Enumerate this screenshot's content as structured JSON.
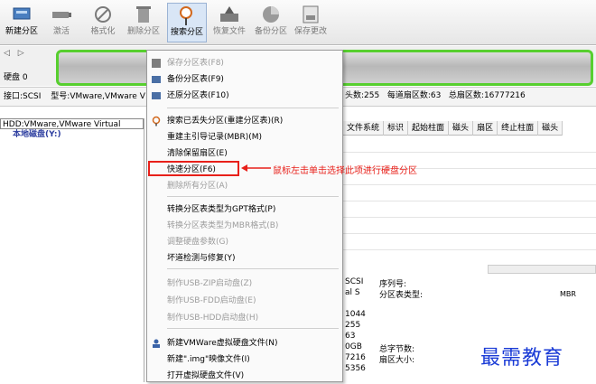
{
  "toolbar": {
    "items": [
      {
        "label": "新建分区",
        "icon": "new-partition-icon"
      },
      {
        "label": "激活",
        "icon": "activate-icon"
      },
      {
        "label": "格式化",
        "icon": "format-icon"
      },
      {
        "label": "删除分区",
        "icon": "delete-partition-icon"
      },
      {
        "label": "搜索分区",
        "icon": "search-partition-icon"
      },
      {
        "label": "恢复文件",
        "icon": "recover-file-icon"
      },
      {
        "label": "备份分区",
        "icon": "backup-partition-icon"
      },
      {
        "label": "保存更改",
        "icon": "save-changes-icon"
      }
    ]
  },
  "disk_panel": {
    "nav": "◁ ▷",
    "disk_label": "硬盘 0"
  },
  "info_bar": {
    "interface": "接口:SCSI",
    "model": "型号:VMware,VMware V",
    "heads": "头数:255",
    "sectors_per_track": "每道扇区数:63",
    "total_sectors": "总扇区数:16777216"
  },
  "tree": {
    "root": "HDD:VMware,VMware Virtual",
    "disk": "本地磁盘(Y:)"
  },
  "grid": {
    "columns": [
      "文件系统",
      "标识",
      "起始柱面",
      "磁头",
      "扇区",
      "终止柱面",
      "磁头"
    ]
  },
  "details": {
    "left_values": [
      "SCSI",
      "al S",
      "1044",
      "255",
      "63",
      "0GB",
      "7216",
      "5356"
    ],
    "labels": [
      "序列号:",
      "分区表类型:",
      "总字节数:",
      "扇区大小:"
    ],
    "partition_table_type_value": "MBR"
  },
  "context_menu": {
    "items": [
      {
        "label": "保存分区表(F8)",
        "disabled": true
      },
      {
        "label": "备份分区表(F9)",
        "disabled": false
      },
      {
        "label": "还原分区表(F10)",
        "disabled": false
      },
      {
        "label": "搜索已丢失分区(重建分区表)(R)",
        "disabled": false
      },
      {
        "label": "重建主引导记录(MBR)(M)",
        "disabled": false
      },
      {
        "label": "清除保留扇区(E)",
        "disabled": false
      },
      {
        "label": "快速分区(F6)",
        "disabled": false
      },
      {
        "label": "删除所有分区(A)",
        "disabled": true
      },
      {
        "label": "转换分区表类型为GPT格式(P)",
        "disabled": false
      },
      {
        "label": "转换分区表类型为MBR格式(B)",
        "disabled": true
      },
      {
        "label": "调整硬盘参数(G)",
        "disabled": true
      },
      {
        "label": "坏道检测与修复(Y)",
        "disabled": false
      },
      {
        "label": "制作USB-ZIP启动盘(Z)",
        "disabled": true
      },
      {
        "label": "制作USB-FDD启动盘(E)",
        "disabled": true
      },
      {
        "label": "制作USB-HDD启动盘(H)",
        "disabled": true
      },
      {
        "label": "新建VMWare虚拟硬盘文件(N)",
        "disabled": false
      },
      {
        "label": "新建\".img\"映像文件(I)",
        "disabled": false
      },
      {
        "label": "打开虚拟硬盘文件(V)",
        "disabled": false
      }
    ]
  },
  "annotation": "鼠标左击单击选择此项进行硬盘分区",
  "watermark": "最需教育",
  "colors": {
    "highlight_red": "#e8201a",
    "disk_green": "#57cf2f",
    "watermark_blue": "#1a3bd6"
  }
}
